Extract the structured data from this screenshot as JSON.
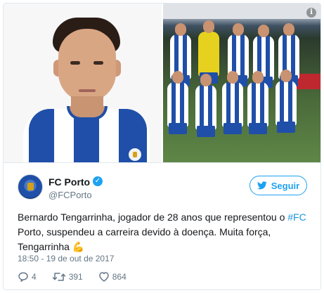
{
  "tweet": {
    "author": {
      "display_name": "FC Porto",
      "handle": "@FCPorto",
      "verified": true
    },
    "follow_label": "Seguir",
    "text_parts": {
      "line_start": "Bernardo Tengarrinha, jogador de 28 anos que representou o ",
      "hashtag": "#FC",
      "line_rest": " Porto, suspendeu a carreira devido à doença. Muita força, Tengarrinha ",
      "emoji": "💪"
    },
    "timestamp": "18:50 - 19 de out de 2017",
    "actions": {
      "replies": "4",
      "retweets": "391",
      "likes": "864"
    }
  },
  "media": {
    "left_photo": "player-portrait",
    "right_photo": "team-photo",
    "info_icon": "i"
  },
  "colors": {
    "accent": "#1da1f2",
    "hashtag": "#1b95e0",
    "muted_text": "#657786",
    "porto_blue": "#1f4fa8"
  }
}
